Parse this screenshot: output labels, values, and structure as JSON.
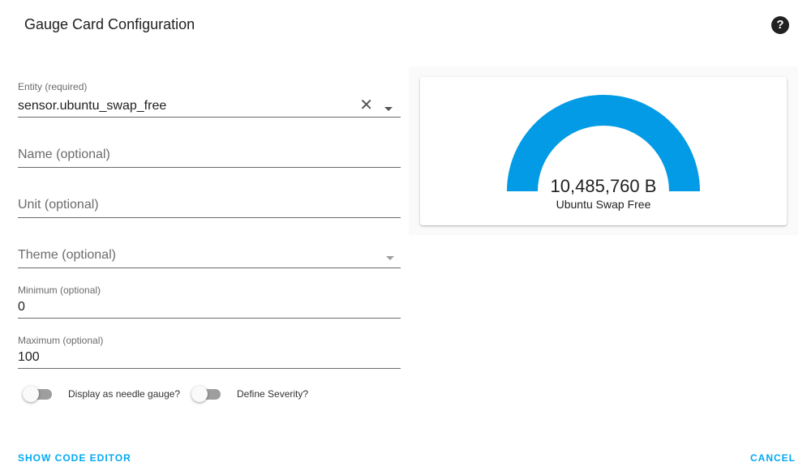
{
  "dialog": {
    "title": "Gauge Card Configuration",
    "help_icon": "help-circle-icon"
  },
  "form": {
    "entity": {
      "label": "Entity (required)",
      "value": "sensor.ubuntu_swap_free"
    },
    "name": {
      "placeholder": "Name (optional)"
    },
    "unit": {
      "placeholder": "Unit (optional)"
    },
    "theme": {
      "placeholder": "Theme (optional)"
    },
    "minimum": {
      "label": "Minimum (optional)",
      "value": "0"
    },
    "maximum": {
      "label": "Maximum (optional)",
      "value": "100"
    },
    "toggles": [
      {
        "label": "Display as needle gauge?",
        "checked": false
      },
      {
        "label": "Define Severity?",
        "checked": false
      }
    ]
  },
  "preview": {
    "gauge_value": "10,485,760 B",
    "gauge_name": "Ubuntu Swap Free",
    "gauge_fill_fraction": 1.0,
    "gauge_color": "#039be5"
  },
  "footer": {
    "show_code_label": "SHOW CODE EDITOR",
    "cancel_label": "CANCEL"
  },
  "colors": {
    "accent": "#03a9f4",
    "gauge": "#039be5"
  }
}
